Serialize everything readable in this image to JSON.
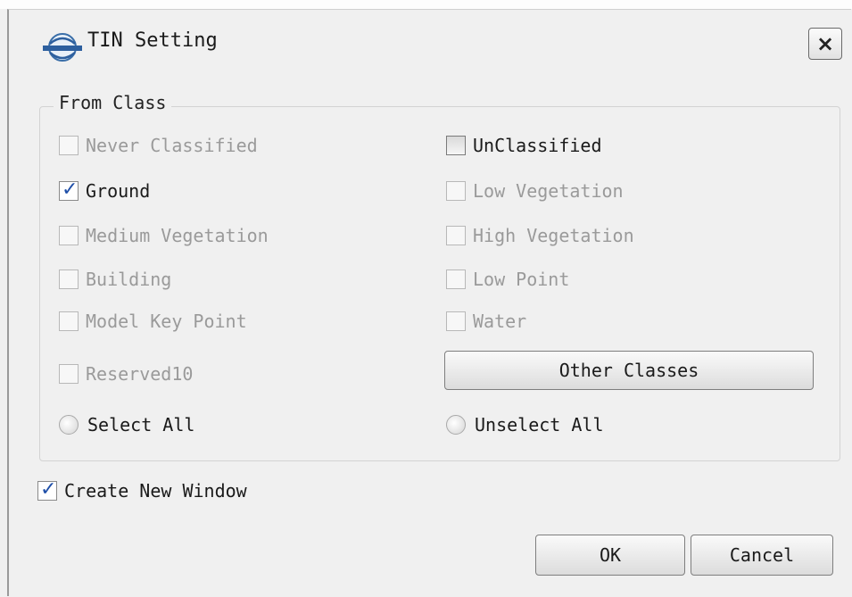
{
  "dialog": {
    "title": "TIN Setting",
    "close_label": "×"
  },
  "from_class": {
    "label": "From Class",
    "options": [
      {
        "label": "Never Classified",
        "checked": false,
        "enabled": false
      },
      {
        "label": "UnClassified",
        "checked": false,
        "enabled": true
      },
      {
        "label": "Ground",
        "checked": true,
        "enabled": true
      },
      {
        "label": "Low Vegetation",
        "checked": false,
        "enabled": false
      },
      {
        "label": "Medium Vegetation",
        "checked": false,
        "enabled": false
      },
      {
        "label": "High Vegetation",
        "checked": false,
        "enabled": false
      },
      {
        "label": "Building",
        "checked": false,
        "enabled": false
      },
      {
        "label": "Low Point",
        "checked": false,
        "enabled": false
      },
      {
        "label": "Model Key Point",
        "checked": false,
        "enabled": false
      },
      {
        "label": "Water",
        "checked": false,
        "enabled": false
      },
      {
        "label": "Reserved10",
        "checked": false,
        "enabled": false
      }
    ],
    "other_classes_label": "Other Classes",
    "select_all_label": "Select All",
    "unselect_all_label": "Unselect All"
  },
  "create_new_window": {
    "label": "Create New Window",
    "checked": true
  },
  "buttons": {
    "ok": "OK",
    "cancel": "Cancel"
  }
}
